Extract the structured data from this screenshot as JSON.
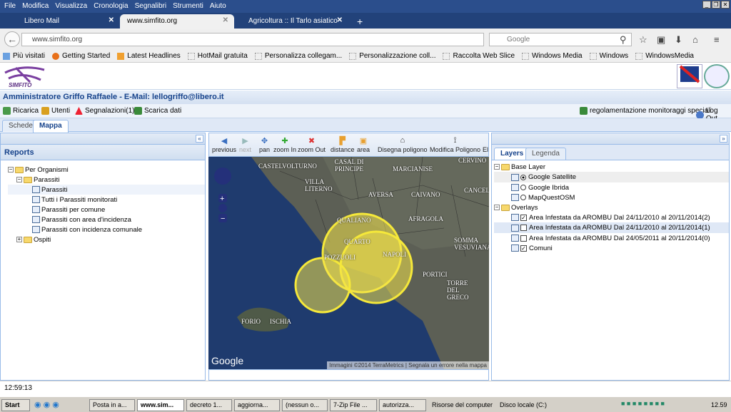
{
  "browser": {
    "menu": [
      "File",
      "Modifica",
      "Visualizza",
      "Cronologia",
      "Segnalibri",
      "Strumenti",
      "Aiuto"
    ],
    "tabs": [
      {
        "label": "Libero Mail"
      },
      {
        "label": "www.simfito.org"
      },
      {
        "label": "Agricoltura :: Il Tarlo asiatico"
      }
    ],
    "url": "www.simfito.org",
    "search_placeholder": "Google",
    "bookmarks": [
      "Più visitati",
      "Getting Started",
      "Latest Headlines",
      "HotMail gratuita",
      "Personalizza collegam...",
      "Personalizzazione coll...",
      "Raccolta Web Slice",
      "Windows Media",
      "Windows",
      "WindowsMedia"
    ]
  },
  "app": {
    "logo_text": "SIMFITO",
    "region_logo": "REGIONE CAMPANIA",
    "title": "Amministratore Griffo Raffaele - E-Mail: lellogriffo@libero.it",
    "toolbar": {
      "reload": "Ricarica",
      "users": "Utenti",
      "reports": "Segnalazioni(1)",
      "download": "Scarica dati",
      "rules": "regolamentazione monitoraggi speciali",
      "logout": "Log Out"
    },
    "tabs": [
      "Schede",
      "Mappa"
    ],
    "active_tab": "Mappa",
    "reports": {
      "title": "Reports",
      "root": "Per Organismi",
      "group": "Parassiti",
      "items": [
        "Parassiti",
        "Tutti i Parassiti monitorati",
        "Parassiti per comune",
        "Parassiti con area d'incidenza",
        "Parassiti con incidenza comunale"
      ],
      "other": "Ospiti"
    },
    "map_toolbar": [
      "previous",
      "next",
      "pan",
      "zoom In",
      "zoom Out",
      "distance",
      "area",
      "Disegna poligono",
      "Modifica Poligono",
      "El"
    ],
    "map": {
      "labels": [
        "CASTELVOLTURNO",
        "CASAL DI PRINCIPE",
        "MARCIANISE",
        "VILLA LITERNO",
        "AVERSA",
        "CAIVANO",
        "QUALIANO",
        "AFRAGOLA",
        "QUARTO",
        "NAPOLI",
        "POZZUOLI",
        "PORTICI",
        "SOMMA VESUVIANA",
        "TORRE DEL GRECO",
        "FORIO",
        "ISCHIA",
        "CANCELLO",
        "CERVINO"
      ],
      "google": "Google",
      "attribution": "Immagini ©2014 TerraMetrics",
      "report_error": "Segnala un errore nella mappa",
      "overlay_color": "#f2e14a"
    },
    "layers": {
      "tabs": [
        "Layers",
        "Legenda"
      ],
      "base_title": "Base Layer",
      "base": [
        {
          "label": "Google Satellite",
          "selected": true
        },
        {
          "label": "Google Ibrida",
          "selected": false
        },
        {
          "label": "MapQuestOSM",
          "selected": false
        }
      ],
      "overlay_title": "Overlays",
      "overlays": [
        {
          "label": "Area Infestata da AROMBU Dal 24/11/2010 al 20/11/2014(2)",
          "checked": true
        },
        {
          "label": "Area Infestata da AROMBU Dal 24/11/2010 al 20/11/2014(1)",
          "checked": false
        },
        {
          "label": "Area Infestata da AROMBU Dal 24/05/2011 al 20/11/2014(0)",
          "checked": false
        },
        {
          "label": "Comuni",
          "checked": true
        }
      ]
    },
    "clock": "12:59:13"
  },
  "taskbar": {
    "start": "Start",
    "items": [
      "Posta in a...",
      "www.sim...",
      "decreto 1...",
      "aggiorna...",
      "(nessun o...",
      "7-Zip File ...",
      "autorizza..."
    ],
    "links": [
      "Risorse del computer",
      "Disco locale (C:)"
    ],
    "time": "12.59"
  }
}
